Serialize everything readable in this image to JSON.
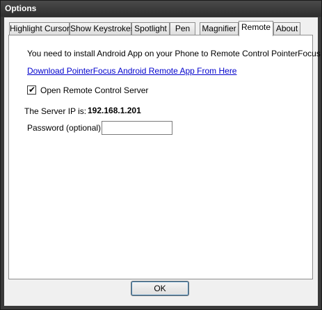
{
  "window": {
    "title": "Options"
  },
  "tabs": [
    {
      "label": "Highlight Cursor"
    },
    {
      "label": "Show Keystrokes"
    },
    {
      "label": "Spotlight"
    },
    {
      "label": "Pen"
    },
    {
      "label": "Magnifier"
    },
    {
      "label": "Remote",
      "active": true
    },
    {
      "label": "About"
    }
  ],
  "remote": {
    "instruction": "You need to install Android App on your  Phone to  Remote Control  PointerFocus",
    "download_link": "Download PointerFocus Android Remote App From Here",
    "open_server_label": "Open Remote Control Server",
    "open_server_checked": true,
    "checkmark": "✔",
    "server_ip_label": "The Server IP is:",
    "server_ip": "192.168.1.201",
    "password_label": "Password (optional):",
    "password_value": ""
  },
  "buttons": {
    "ok": "OK"
  }
}
